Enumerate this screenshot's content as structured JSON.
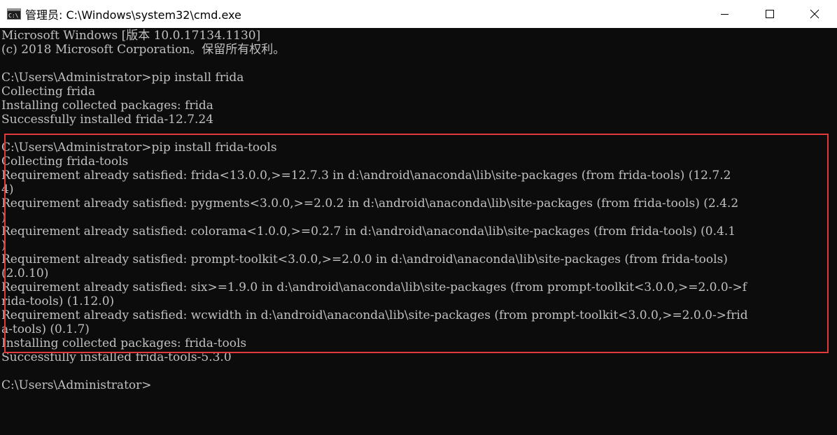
{
  "window": {
    "title": "管理员: C:\\Windows\\system32\\cmd.exe",
    "minimize_label": "minimize",
    "maximize_label": "maximize",
    "close_label": "close"
  },
  "colors": {
    "console_bg": "#0c0c0c",
    "console_text": "#c0c0c0",
    "highlight_border": "#e23a3a",
    "titlebar_bg": "#ffffff"
  },
  "console": {
    "lines": [
      "Microsoft Windows [版本 10.0.17134.1130]",
      "(c) 2018 Microsoft Corporation。保留所有权利。",
      "",
      "C:\\Users\\Administrator>pip install frida",
      "Collecting frida",
      "Installing collected packages: frida",
      "Successfully installed frida-12.7.24",
      "",
      "C:\\Users\\Administrator>pip install frida-tools",
      "Collecting frida-tools",
      "Requirement already satisfied: frida<13.0.0,>=12.7.3 in d:\\android\\anaconda\\lib\\site-packages (from frida-tools) (12.7.2",
      "4)",
      "Requirement already satisfied: pygments<3.0.0,>=2.0.2 in d:\\android\\anaconda\\lib\\site-packages (from frida-tools) (2.4.2",
      ")",
      "Requirement already satisfied: colorama<1.0.0,>=0.2.7 in d:\\android\\anaconda\\lib\\site-packages (from frida-tools) (0.4.1",
      ")",
      "Requirement already satisfied: prompt-toolkit<3.0.0,>=2.0.0 in d:\\android\\anaconda\\lib\\site-packages (from frida-tools)",
      "(2.0.10)",
      "Requirement already satisfied: six>=1.9.0 in d:\\android\\anaconda\\lib\\site-packages (from prompt-toolkit<3.0.0,>=2.0.0->f",
      "rida-tools) (1.12.0)",
      "Requirement already satisfied: wcwidth in d:\\android\\anaconda\\lib\\site-packages (from prompt-toolkit<3.0.0,>=2.0.0->frid",
      "a-tools) (0.1.7)",
      "Installing collected packages: frida-tools",
      "Successfully installed frida-tools-5.3.0",
      "",
      "C:\\Users\\Administrator>"
    ]
  }
}
